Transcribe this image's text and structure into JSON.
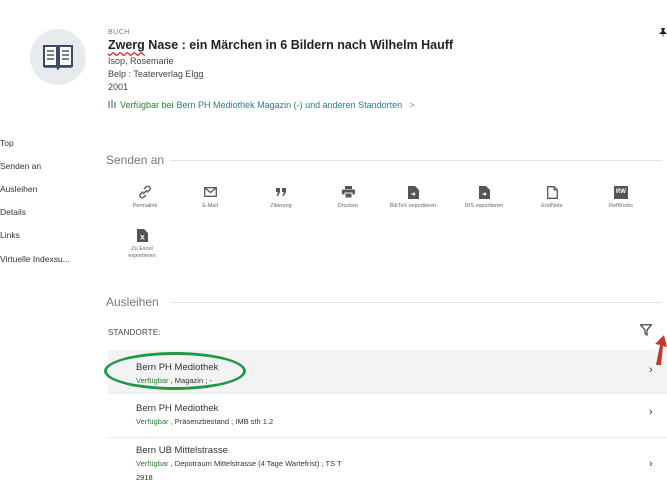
{
  "record": {
    "type": "BUCH",
    "title_marked": "Zwerg",
    "title_rest": " Nase : ein Märchen in 6 Bildern nach Wilhelm Hauff",
    "author": "Isop, Rosemarie",
    "publisher": "Belp : Teaterverlag Elgg",
    "year": "2001",
    "availability_status": "Verfügbar bei",
    "availability_location": "Bern PH Mediothek  Magazin (-) und anderen Standorten",
    "availability_chevron": ">"
  },
  "side_nav": {
    "items": [
      "Top",
      "Senden an",
      "Ausleihen",
      "Details",
      "Links",
      "Virtuelle Indexsu..."
    ]
  },
  "send_section": {
    "title": "Senden an",
    "actions": [
      {
        "label": "Permalink",
        "icon": "link-icon"
      },
      {
        "label": "E-Mail",
        "icon": "envelope-icon"
      },
      {
        "label": "Zitierung",
        "icon": "quote-icon"
      },
      {
        "label": "Drucken",
        "icon": "printer-icon"
      },
      {
        "label": "BibTeX exportieren",
        "icon": "file-export-icon"
      },
      {
        "label": "RIS exportieren",
        "icon": "file-export-icon"
      },
      {
        "label": "EndNote",
        "icon": "document-icon"
      },
      {
        "label": "RefWorks",
        "icon": "refworks-icon",
        "badge": "RW"
      },
      {
        "label": "Zu Excel exportieren",
        "icon": "excel-icon",
        "badge": "X"
      }
    ]
  },
  "borrow_section": {
    "title": "Ausleihen",
    "standorte_label": "STANDORTE:",
    "locations": [
      {
        "name": "Bern PH Mediothek",
        "status": "Verfügbar",
        "detail": " , Magazin ; -",
        "extra": ""
      },
      {
        "name": "Bern PH Mediothek",
        "status": "Verfügbar",
        "detail": " , Präsenzbestand ; IMB sth 1.2",
        "extra": ""
      },
      {
        "name": "Bern UB Mittelstrasse",
        "status": "Verfügbar",
        "detail": " , Depotraum Mittelstrasse (4 Tage Wartefrist) ; TS T",
        "extra": "2918"
      }
    ],
    "chevron": "›"
  },
  "colors": {
    "available_green": "#2e7d32",
    "link_teal": "#2f7b8a",
    "annotation_oval": "#1e9a46",
    "annotation_arrow": "#c0392b"
  }
}
